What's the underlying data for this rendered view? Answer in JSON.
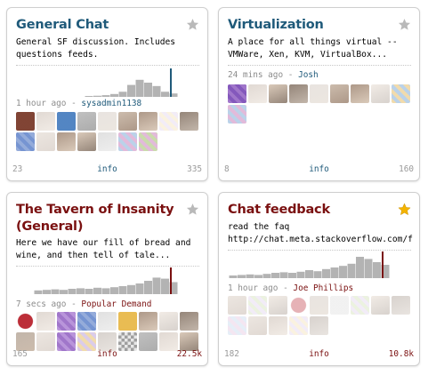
{
  "colors": {
    "title_blue": "#1f5a7a",
    "title_maroon": "#7a1010",
    "star_off": "#b9b9b9",
    "star_on": "#f4b400",
    "bar_gray": "#b3b3b3",
    "marker_blue": "#1f5a7a",
    "marker_maroon": "#7a1010"
  },
  "rooms": [
    {
      "title": "General Chat",
      "description": [
        "General SF discussion. Includes",
        "questions feeds."
      ],
      "activity_time": "1 hour ago",
      "activity_user": "sysadmin1138",
      "user_count": "23",
      "info_label": "info",
      "message_count": "335",
      "starred": false,
      "accent": "blue",
      "activity_levels": [
        0.02,
        0.04,
        0.06,
        0.1,
        0.18,
        0.42,
        0.6,
        0.5,
        0.38,
        0.18,
        0.12
      ],
      "avatar_icons": [
        "bug-logo-avatar",
        "face-avatar",
        "z-logo-avatar",
        "gray-avatar",
        "face-avatar",
        "face-avatar",
        "face-avatar",
        "pattern-avatar",
        "face-avatar",
        "blue-pattern-avatar",
        "face-avatar",
        "face-avatar",
        "face-avatar",
        "gray-avatar",
        "pattern-avatar",
        "pattern-avatar"
      ]
    },
    {
      "title": "Virtualization",
      "description": [
        "A place for all things virtual --",
        "VMWare, Xen, KVM, VirtualBox..."
      ],
      "activity_time": "24 mins ago",
      "activity_user": "Josh",
      "user_count": "8",
      "info_label": "info",
      "message_count": "160",
      "starred": false,
      "accent": "blue",
      "activity_levels": [],
      "avatar_icons": [
        "purple-pattern-avatar",
        "face-avatar",
        "face-avatar",
        "face-avatar",
        "face-avatar",
        "face-avatar",
        "face-avatar",
        "face-avatar",
        "pattern-avatar",
        "pattern-avatar"
      ]
    },
    {
      "title": "The Tavern of Insanity (General)",
      "description": [
        "Here we have our fill of bread and",
        "wine, and then tell of tale..."
      ],
      "activity_time": "7 secs ago",
      "activity_user": "Popular Demand",
      "user_count": "165",
      "info_label": "info",
      "message_count": "22.5k",
      "starred": false,
      "accent": "maroon",
      "activity_levels": [
        0.14,
        0.16,
        0.18,
        0.16,
        0.2,
        0.22,
        0.2,
        0.24,
        0.22,
        0.26,
        0.3,
        0.34,
        0.4,
        0.5,
        0.62,
        0.58,
        0.45
      ],
      "avatar_icons": [
        "seal-avatar",
        "face-avatar",
        "purple-pattern-avatar",
        "blue-pattern-avatar",
        "gray-avatar",
        "monkey-avatar",
        "face-avatar",
        "face-avatar",
        "face-avatar",
        "face-avatar",
        "face-avatar",
        "purple-pattern-avatar",
        "pattern-avatar",
        "face-avatar",
        "qr-avatar",
        "gray-avatar",
        "face-avatar",
        "face-avatar"
      ]
    },
    {
      "title": "Chat feedback",
      "description": [
        "read the faq",
        "http://chat.meta.stackoverflow.com/faq"
      ],
      "activity_time": "1 hour ago",
      "activity_user": "Joe Phillips",
      "user_count": "182",
      "info_label": "info",
      "message_count": "10.8k",
      "starred": true,
      "accent": "maroon",
      "activity_levels": [
        0.1,
        0.12,
        0.14,
        0.12,
        0.16,
        0.2,
        0.22,
        0.2,
        0.24,
        0.3,
        0.26,
        0.34,
        0.4,
        0.46,
        0.54,
        0.8,
        0.72,
        0.6,
        0.5
      ],
      "avatar_icons": [
        "face-avatar",
        "pattern-avatar",
        "face-avatar",
        "seal-avatar",
        "face-avatar",
        "chess-avatar",
        "pattern-avatar",
        "face-avatar",
        "face-avatar",
        "pattern-avatar",
        "face-avatar",
        "face-avatar",
        "pattern-avatar",
        "face-avatar"
      ]
    }
  ]
}
